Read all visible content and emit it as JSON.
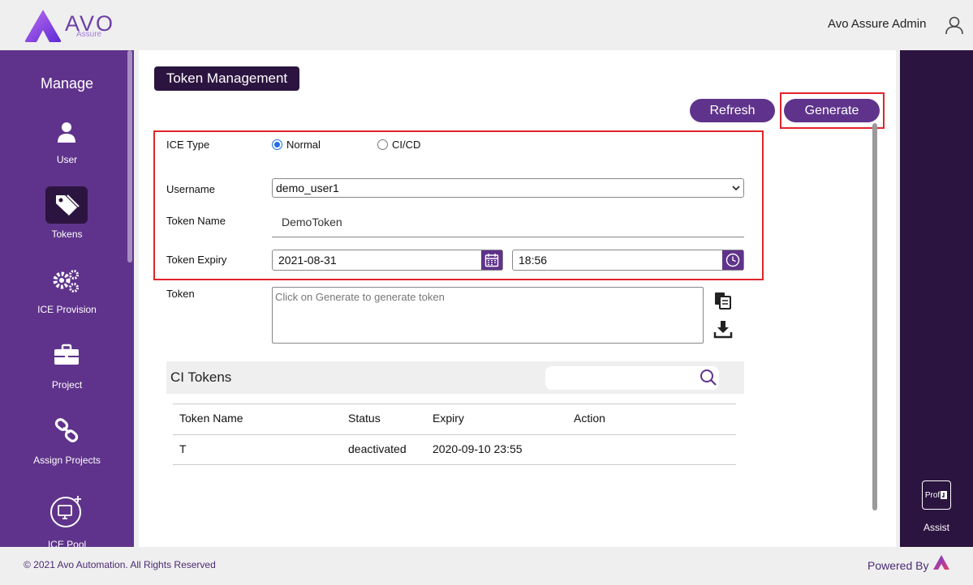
{
  "header": {
    "logo_text": "AVO",
    "logo_sub": "Assure",
    "user_name": "Avo Assure Admin"
  },
  "sidebar": {
    "title": "Manage",
    "items": [
      {
        "label": "User",
        "icon": "user-icon"
      },
      {
        "label": "Tokens",
        "icon": "tag-icon",
        "active": true
      },
      {
        "label": "ICE Provision",
        "icon": "gears-icon"
      },
      {
        "label": "Project",
        "icon": "briefcase-icon"
      },
      {
        "label": "Assign Projects",
        "icon": "link-icon"
      },
      {
        "label": "ICE Pool",
        "icon": "ice-pool-icon"
      }
    ]
  },
  "page": {
    "title": "Token Management",
    "refresh_label": "Refresh",
    "generate_label": "Generate"
  },
  "form": {
    "ice_type_label": "ICE Type",
    "ice_type_options": [
      {
        "label": "Normal",
        "selected": true
      },
      {
        "label": "CI/CD",
        "selected": false
      }
    ],
    "username_label": "Username",
    "username_value": "demo_user1",
    "token_name_label": "Token Name",
    "token_name_value": "DemoToken",
    "token_expiry_label": "Token Expiry",
    "expiry_date": "2021-08-31",
    "expiry_time": "18:56",
    "token_label": "Token",
    "token_placeholder": "Click on Generate to generate token"
  },
  "ci_tokens": {
    "title": "CI Tokens",
    "search_value": "",
    "columns": [
      "Token Name",
      "Status",
      "Expiry",
      "Action"
    ],
    "rows": [
      {
        "token_name": "T",
        "status": "deactivated",
        "expiry": "2020-09-10 23:55",
        "action": ""
      }
    ]
  },
  "right_panel": {
    "prof_label": "Prof",
    "assist_label": "Assist"
  },
  "footer": {
    "copyright": "© 2021 Avo Automation. All Rights Reserved",
    "powered_by": "Powered By"
  },
  "colors": {
    "primary": "#5f338b",
    "dark": "#2c1440",
    "highlight": "#e1242b",
    "radio": "#1f6fe5"
  }
}
